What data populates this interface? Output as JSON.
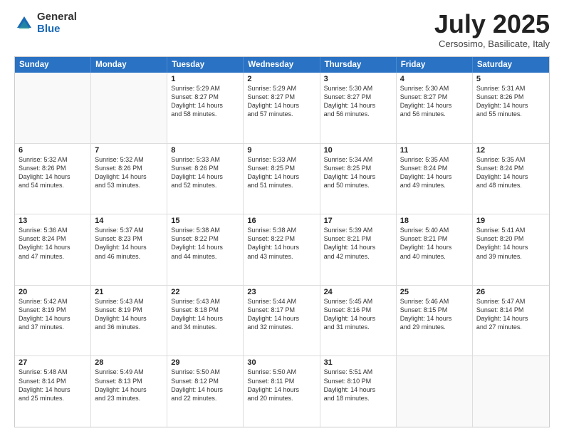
{
  "logo": {
    "general": "General",
    "blue": "Blue"
  },
  "header": {
    "month": "July 2025",
    "location": "Cersosimo, Basilicate, Italy"
  },
  "days": [
    "Sunday",
    "Monday",
    "Tuesday",
    "Wednesday",
    "Thursday",
    "Friday",
    "Saturday"
  ],
  "rows": [
    [
      {
        "day": "",
        "empty": true
      },
      {
        "day": "",
        "empty": true
      },
      {
        "day": "1",
        "line1": "Sunrise: 5:29 AM",
        "line2": "Sunset: 8:27 PM",
        "line3": "Daylight: 14 hours",
        "line4": "and 58 minutes."
      },
      {
        "day": "2",
        "line1": "Sunrise: 5:29 AM",
        "line2": "Sunset: 8:27 PM",
        "line3": "Daylight: 14 hours",
        "line4": "and 57 minutes."
      },
      {
        "day": "3",
        "line1": "Sunrise: 5:30 AM",
        "line2": "Sunset: 8:27 PM",
        "line3": "Daylight: 14 hours",
        "line4": "and 56 minutes."
      },
      {
        "day": "4",
        "line1": "Sunrise: 5:30 AM",
        "line2": "Sunset: 8:27 PM",
        "line3": "Daylight: 14 hours",
        "line4": "and 56 minutes."
      },
      {
        "day": "5",
        "line1": "Sunrise: 5:31 AM",
        "line2": "Sunset: 8:26 PM",
        "line3": "Daylight: 14 hours",
        "line4": "and 55 minutes."
      }
    ],
    [
      {
        "day": "6",
        "line1": "Sunrise: 5:32 AM",
        "line2": "Sunset: 8:26 PM",
        "line3": "Daylight: 14 hours",
        "line4": "and 54 minutes."
      },
      {
        "day": "7",
        "line1": "Sunrise: 5:32 AM",
        "line2": "Sunset: 8:26 PM",
        "line3": "Daylight: 14 hours",
        "line4": "and 53 minutes."
      },
      {
        "day": "8",
        "line1": "Sunrise: 5:33 AM",
        "line2": "Sunset: 8:26 PM",
        "line3": "Daylight: 14 hours",
        "line4": "and 52 minutes."
      },
      {
        "day": "9",
        "line1": "Sunrise: 5:33 AM",
        "line2": "Sunset: 8:25 PM",
        "line3": "Daylight: 14 hours",
        "line4": "and 51 minutes."
      },
      {
        "day": "10",
        "line1": "Sunrise: 5:34 AM",
        "line2": "Sunset: 8:25 PM",
        "line3": "Daylight: 14 hours",
        "line4": "and 50 minutes."
      },
      {
        "day": "11",
        "line1": "Sunrise: 5:35 AM",
        "line2": "Sunset: 8:24 PM",
        "line3": "Daylight: 14 hours",
        "line4": "and 49 minutes."
      },
      {
        "day": "12",
        "line1": "Sunrise: 5:35 AM",
        "line2": "Sunset: 8:24 PM",
        "line3": "Daylight: 14 hours",
        "line4": "and 48 minutes."
      }
    ],
    [
      {
        "day": "13",
        "line1": "Sunrise: 5:36 AM",
        "line2": "Sunset: 8:24 PM",
        "line3": "Daylight: 14 hours",
        "line4": "and 47 minutes."
      },
      {
        "day": "14",
        "line1": "Sunrise: 5:37 AM",
        "line2": "Sunset: 8:23 PM",
        "line3": "Daylight: 14 hours",
        "line4": "and 46 minutes."
      },
      {
        "day": "15",
        "line1": "Sunrise: 5:38 AM",
        "line2": "Sunset: 8:22 PM",
        "line3": "Daylight: 14 hours",
        "line4": "and 44 minutes."
      },
      {
        "day": "16",
        "line1": "Sunrise: 5:38 AM",
        "line2": "Sunset: 8:22 PM",
        "line3": "Daylight: 14 hours",
        "line4": "and 43 minutes."
      },
      {
        "day": "17",
        "line1": "Sunrise: 5:39 AM",
        "line2": "Sunset: 8:21 PM",
        "line3": "Daylight: 14 hours",
        "line4": "and 42 minutes."
      },
      {
        "day": "18",
        "line1": "Sunrise: 5:40 AM",
        "line2": "Sunset: 8:21 PM",
        "line3": "Daylight: 14 hours",
        "line4": "and 40 minutes."
      },
      {
        "day": "19",
        "line1": "Sunrise: 5:41 AM",
        "line2": "Sunset: 8:20 PM",
        "line3": "Daylight: 14 hours",
        "line4": "and 39 minutes."
      }
    ],
    [
      {
        "day": "20",
        "line1": "Sunrise: 5:42 AM",
        "line2": "Sunset: 8:19 PM",
        "line3": "Daylight: 14 hours",
        "line4": "and 37 minutes."
      },
      {
        "day": "21",
        "line1": "Sunrise: 5:43 AM",
        "line2": "Sunset: 8:19 PM",
        "line3": "Daylight: 14 hours",
        "line4": "and 36 minutes."
      },
      {
        "day": "22",
        "line1": "Sunrise: 5:43 AM",
        "line2": "Sunset: 8:18 PM",
        "line3": "Daylight: 14 hours",
        "line4": "and 34 minutes."
      },
      {
        "day": "23",
        "line1": "Sunrise: 5:44 AM",
        "line2": "Sunset: 8:17 PM",
        "line3": "Daylight: 14 hours",
        "line4": "and 32 minutes."
      },
      {
        "day": "24",
        "line1": "Sunrise: 5:45 AM",
        "line2": "Sunset: 8:16 PM",
        "line3": "Daylight: 14 hours",
        "line4": "and 31 minutes."
      },
      {
        "day": "25",
        "line1": "Sunrise: 5:46 AM",
        "line2": "Sunset: 8:15 PM",
        "line3": "Daylight: 14 hours",
        "line4": "and 29 minutes."
      },
      {
        "day": "26",
        "line1": "Sunrise: 5:47 AM",
        "line2": "Sunset: 8:14 PM",
        "line3": "Daylight: 14 hours",
        "line4": "and 27 minutes."
      }
    ],
    [
      {
        "day": "27",
        "line1": "Sunrise: 5:48 AM",
        "line2": "Sunset: 8:14 PM",
        "line3": "Daylight: 14 hours",
        "line4": "and 25 minutes."
      },
      {
        "day": "28",
        "line1": "Sunrise: 5:49 AM",
        "line2": "Sunset: 8:13 PM",
        "line3": "Daylight: 14 hours",
        "line4": "and 23 minutes."
      },
      {
        "day": "29",
        "line1": "Sunrise: 5:50 AM",
        "line2": "Sunset: 8:12 PM",
        "line3": "Daylight: 14 hours",
        "line4": "and 22 minutes."
      },
      {
        "day": "30",
        "line1": "Sunrise: 5:50 AM",
        "line2": "Sunset: 8:11 PM",
        "line3": "Daylight: 14 hours",
        "line4": "and 20 minutes."
      },
      {
        "day": "31",
        "line1": "Sunrise: 5:51 AM",
        "line2": "Sunset: 8:10 PM",
        "line3": "Daylight: 14 hours",
        "line4": "and 18 minutes."
      },
      {
        "day": "",
        "empty": true
      },
      {
        "day": "",
        "empty": true
      }
    ]
  ]
}
